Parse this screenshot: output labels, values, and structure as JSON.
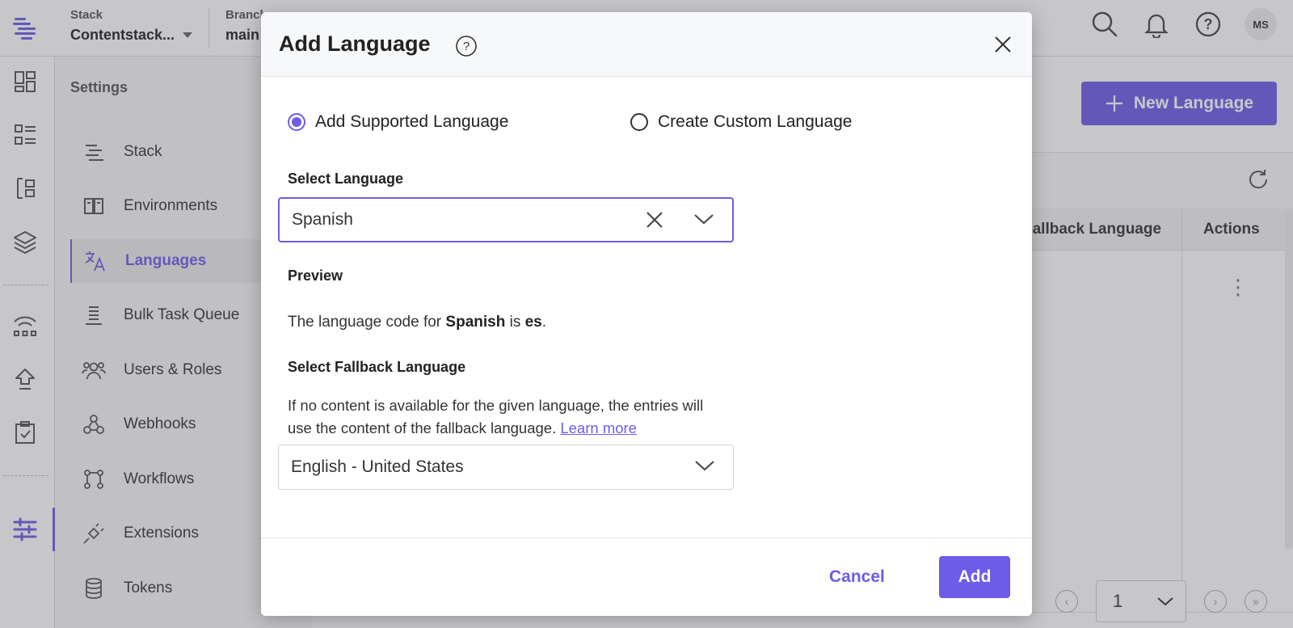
{
  "header": {
    "stack_label": "Stack",
    "stack_name": "Contentstack...",
    "branch_label": "Branch",
    "branch_name": "main",
    "avatar_initials": "MS"
  },
  "settings": {
    "title": "Settings",
    "items": [
      {
        "label": "Stack",
        "icon": "stack-icon"
      },
      {
        "label": "Environments",
        "icon": "environments-icon"
      },
      {
        "label": "Languages",
        "icon": "translate-icon",
        "active": true
      },
      {
        "label": "Bulk Task Queue",
        "icon": "queue-icon"
      },
      {
        "label": "Users & Roles",
        "icon": "users-icon"
      },
      {
        "label": "Webhooks",
        "icon": "webhooks-icon"
      },
      {
        "label": "Workflows",
        "icon": "workflows-icon"
      },
      {
        "label": "Extensions",
        "icon": "plug-icon"
      },
      {
        "label": "Tokens",
        "icon": "database-icon"
      }
    ]
  },
  "main": {
    "new_language_label": "New Language",
    "columns": {
      "fallback": "Fallback Language",
      "actions": "Actions"
    },
    "pager_page": "1"
  },
  "modal": {
    "title": "Add Language",
    "radio_supported": "Add Supported Language",
    "radio_custom": "Create Custom Language",
    "select_language_label": "Select Language",
    "select_language_value": "Spanish",
    "preview_label": "Preview",
    "preview_prefix": "The language code for ",
    "preview_language": "Spanish",
    "preview_mid": " is ",
    "preview_code": "es",
    "preview_suffix": ".",
    "fallback_label": "Select Fallback Language",
    "fallback_desc": "If no content is available for the given language, the entries will use the content of the fallback language.",
    "learn_more": "Learn more",
    "fallback_value": "English - United States",
    "cancel_label": "Cancel",
    "add_label": "Add"
  },
  "colors": {
    "accent": "#6c5ce7"
  }
}
